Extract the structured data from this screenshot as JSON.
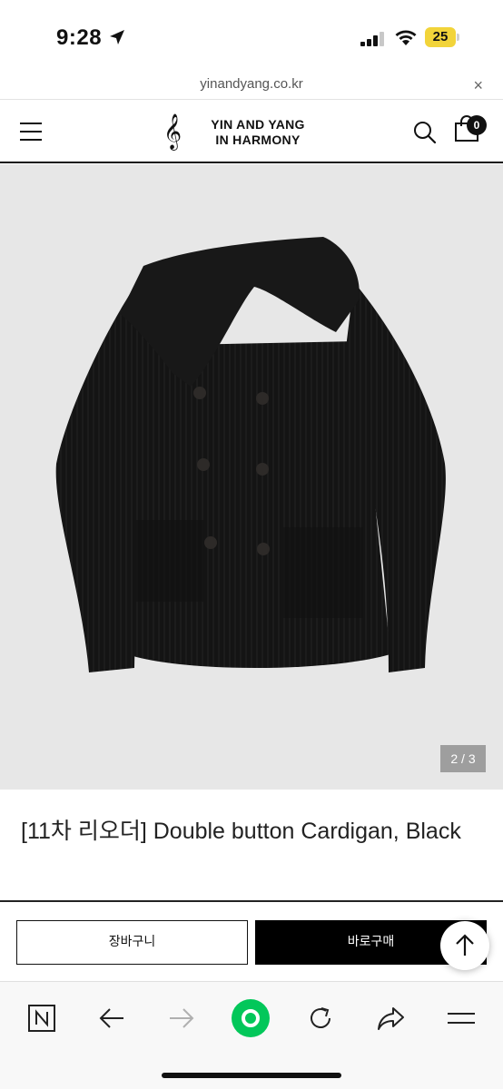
{
  "status_bar": {
    "time": "9:28",
    "battery": "25"
  },
  "url_bar": {
    "url": "yinandyang.co.kr",
    "close": "×"
  },
  "header": {
    "logo_line1": "YIN AND YANG",
    "logo_line2": "IN HARMONY",
    "logo_mark": "𝄞",
    "cart_count": "0"
  },
  "product": {
    "slide_counter": "2 / 3",
    "title": "[11차 리오더] Double button Cardigan, Black"
  },
  "purchase": {
    "cart_label": "장바구니",
    "buy_label": "바로구매"
  },
  "colors": {
    "accent": "#000000",
    "image_bg": "#e7e7e7",
    "naver_green": "#03c75a",
    "battery": "#f2d43a"
  },
  "toolbar": {
    "items": [
      "naver-home-icon",
      "back-arrow-icon",
      "forward-arrow-icon",
      "naver-green-icon",
      "refresh-icon",
      "share-icon",
      "menu-icon"
    ]
  }
}
